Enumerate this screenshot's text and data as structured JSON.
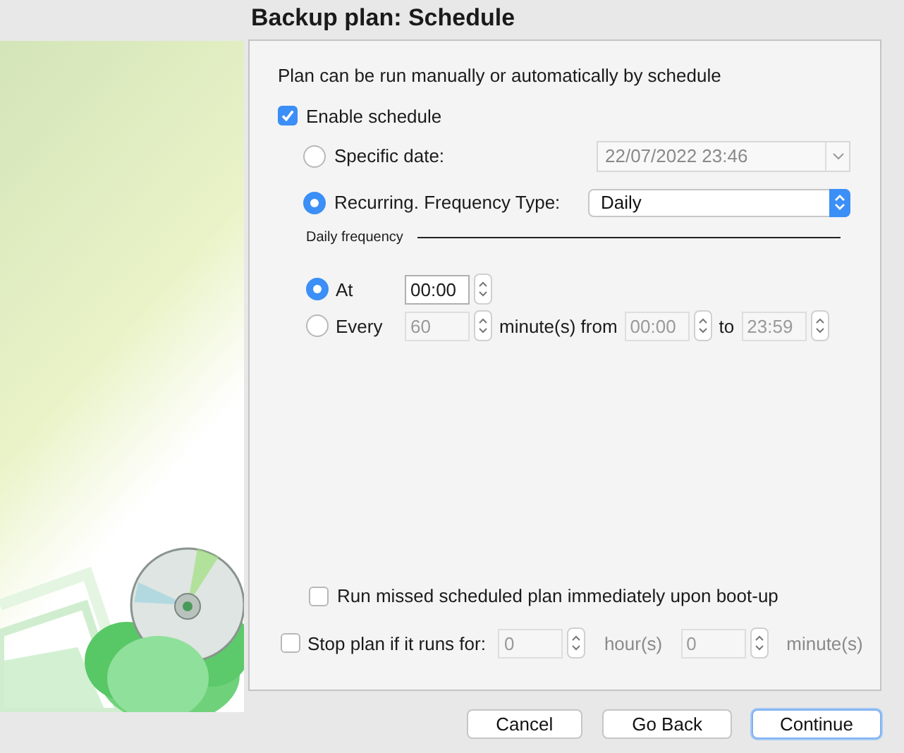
{
  "title": "Backup plan: Schedule",
  "intro": "Plan can be run manually or automatically by schedule",
  "enable_schedule": {
    "label": "Enable schedule",
    "checked": true
  },
  "schedule_modes": [
    {
      "label": "Specific date:",
      "selected": false,
      "kind": "date",
      "value": "22/07/2022 23:46",
      "disabled": true
    },
    {
      "label": "Recurring. Frequency Type:",
      "selected": true,
      "kind": "select",
      "value": "Daily",
      "disabled": false
    }
  ],
  "daily_frequency": {
    "title": "Daily frequency",
    "options": [
      {
        "label": "At",
        "selected": true,
        "items": [
          {
            "kind": "stepper",
            "value": "00:00",
            "disabled": false
          }
        ]
      },
      {
        "label": "Every",
        "selected": false,
        "items": [
          {
            "kind": "stepper",
            "value": "60",
            "disabled": true
          },
          {
            "kind": "text",
            "text": "minute(s) from",
            "disabled": false
          },
          {
            "kind": "stepper",
            "value": "00:00",
            "disabled": true
          },
          {
            "kind": "text",
            "text": "to",
            "disabled": false
          },
          {
            "kind": "stepper",
            "value": "23:59",
            "disabled": true
          }
        ]
      }
    ]
  },
  "run_missed": {
    "label": "Run missed scheduled plan immediately upon boot-up",
    "checked": false
  },
  "stop_plan": {
    "label": "Stop plan if it runs for:",
    "checked": false,
    "items": [
      {
        "kind": "stepper",
        "value": "0",
        "disabled": true
      },
      {
        "kind": "text",
        "text": "hour(s)",
        "disabled": true
      },
      {
        "kind": "stepper",
        "value": "0",
        "disabled": true
      },
      {
        "kind": "text",
        "text": "minute(s)",
        "disabled": true
      }
    ]
  },
  "buttons": [
    {
      "label": "Cancel",
      "default": false
    },
    {
      "label": "Go Back",
      "default": false
    },
    {
      "label": "Continue",
      "default": true
    }
  ]
}
